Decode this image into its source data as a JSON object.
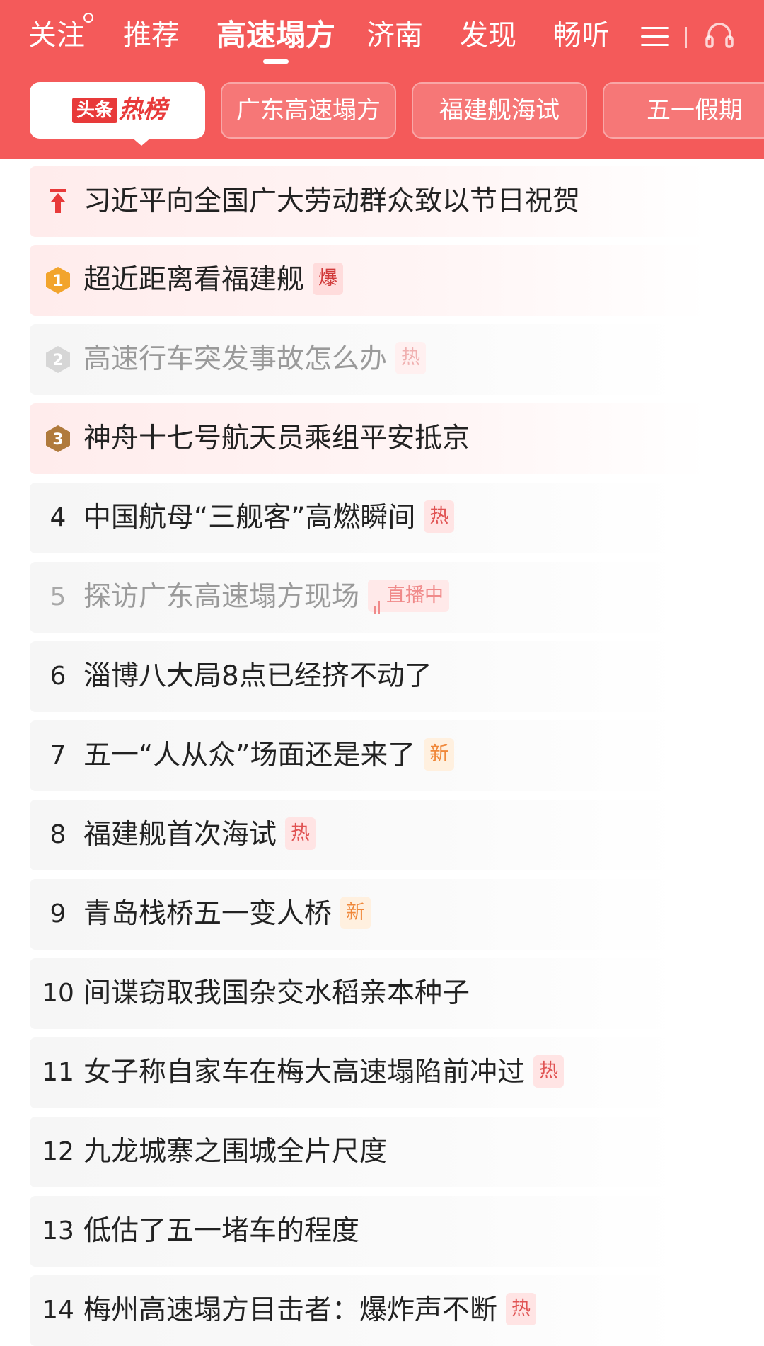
{
  "nav": {
    "tabs": [
      {
        "label": "关注"
      },
      {
        "label": "推荐"
      },
      {
        "label": "高速塌方"
      },
      {
        "label": "济南"
      },
      {
        "label": "发现"
      },
      {
        "label": "畅听"
      }
    ],
    "active_tab": "高速塌方",
    "menu_icon": "menu-icon",
    "headphone_icon": "headphone-icon"
  },
  "chips": {
    "logo": {
      "box_text": "头条",
      "text": "热榜"
    },
    "items": [
      {
        "label": "广东高速塌方"
      },
      {
        "label": "福建舰海试"
      },
      {
        "label": "五一假期"
      }
    ]
  },
  "list": [
    {
      "rank": "",
      "marker": "pinned-top-icon",
      "title": "习近平向全国广大劳动群众致以节日祝贺",
      "badge": null
    },
    {
      "rank": "1",
      "marker": "gold-medal",
      "title": "超近距离看福建舰",
      "badge": "爆"
    },
    {
      "rank": "2",
      "marker": "silver-medal",
      "title": "高速行车突发事故怎么办",
      "badge": "热"
    },
    {
      "rank": "3",
      "marker": "bronze-medal",
      "title": "神舟十七号航天员乘组平安抵京",
      "badge": null
    },
    {
      "rank": "4",
      "title": "中国航母“三舰客”高燃瞬间",
      "badge": "热"
    },
    {
      "rank": "5",
      "title": "探访广东高速塌方现场",
      "badge": "直播中"
    },
    {
      "rank": "6",
      "title": "淄博八大局8点已经挤不动了",
      "badge": null
    },
    {
      "rank": "7",
      "title": "五一“人从众”场面还是来了",
      "badge": "新"
    },
    {
      "rank": "8",
      "title": "福建舰首次海试",
      "badge": "热"
    },
    {
      "rank": "9",
      "title": "青岛栈桥五一变人桥",
      "badge": "新"
    },
    {
      "rank": "10",
      "title": "间谍窃取我国杂交水稻亲本种子",
      "badge": null
    },
    {
      "rank": "11",
      "title": "女子称自家车在梅大高速塌陷前冲过",
      "badge": "热"
    },
    {
      "rank": "12",
      "title": "九龙城寨之围城全片尺度",
      "badge": null
    },
    {
      "rank": "13",
      "title": "低估了五一堵车的程度",
      "badge": null
    },
    {
      "rank": "14",
      "title": "梅州高速塌方目击者：爆炸声不断",
      "badge": "热"
    }
  ],
  "colors": {
    "header_bg": "#f45a5a",
    "brand_red": "#e83a3a",
    "gold": "#f2a42c",
    "silver": "#d6d6d6",
    "bronze": "#b07a3c"
  }
}
